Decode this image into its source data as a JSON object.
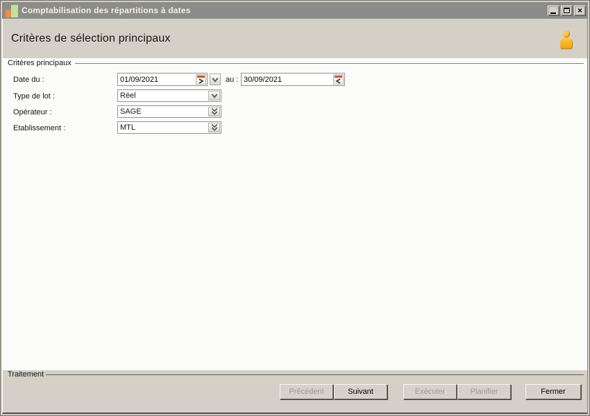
{
  "window": {
    "title": "Comptabilisation des répartitions à dates",
    "controls": {
      "minimize": "minimize",
      "maximize": "maximize",
      "close": "×"
    }
  },
  "header": {
    "title": "Critères de sélection principaux"
  },
  "main": {
    "group_label": "Critères principaux",
    "fields": [
      {
        "id": "date",
        "label": "Date du :",
        "value": "01/09/2021",
        "to_label": "au :",
        "to_value": "30/09/2021"
      },
      {
        "id": "lot_type",
        "label": "Type de lot :",
        "value": "Réel"
      },
      {
        "id": "operator",
        "label": "Opérateur :",
        "value": "SAGE"
      },
      {
        "id": "establishment",
        "label": "Etablissement :",
        "value": "MTL"
      }
    ]
  },
  "footer": {
    "group_label": "Traitement",
    "buttons": [
      {
        "label": "Précédent",
        "enabled": false
      },
      {
        "label": "Suivant",
        "enabled": true
      },
      {
        "label": "Exécuter",
        "enabled": false
      },
      {
        "label": "Planifier",
        "enabled": false
      },
      {
        "label": "Fermer",
        "enabled": true
      }
    ]
  },
  "icons": {
    "titlebar_logo": "orange-green-bars",
    "user": "orange-person",
    "date_from_picker": "red-bar-right-chevron",
    "date_from_dropdown": "chevron-down",
    "date_to_picker": "red-bar-left-chevron",
    "lot_dropdown": "chevron-down",
    "operator_dropdown": "double-chevron-down",
    "establishment_dropdown": "double-chevron-down"
  },
  "colors": {
    "titlebar_bg": "#8c8c88",
    "window_bg": "#d4d0c8",
    "content_bg": "#fbfbf9",
    "accent_red_orange": "#d0502b",
    "person_orange": "#f2a51d",
    "logo_orange": "#ef8b45",
    "logo_green": "#c3e09b"
  }
}
